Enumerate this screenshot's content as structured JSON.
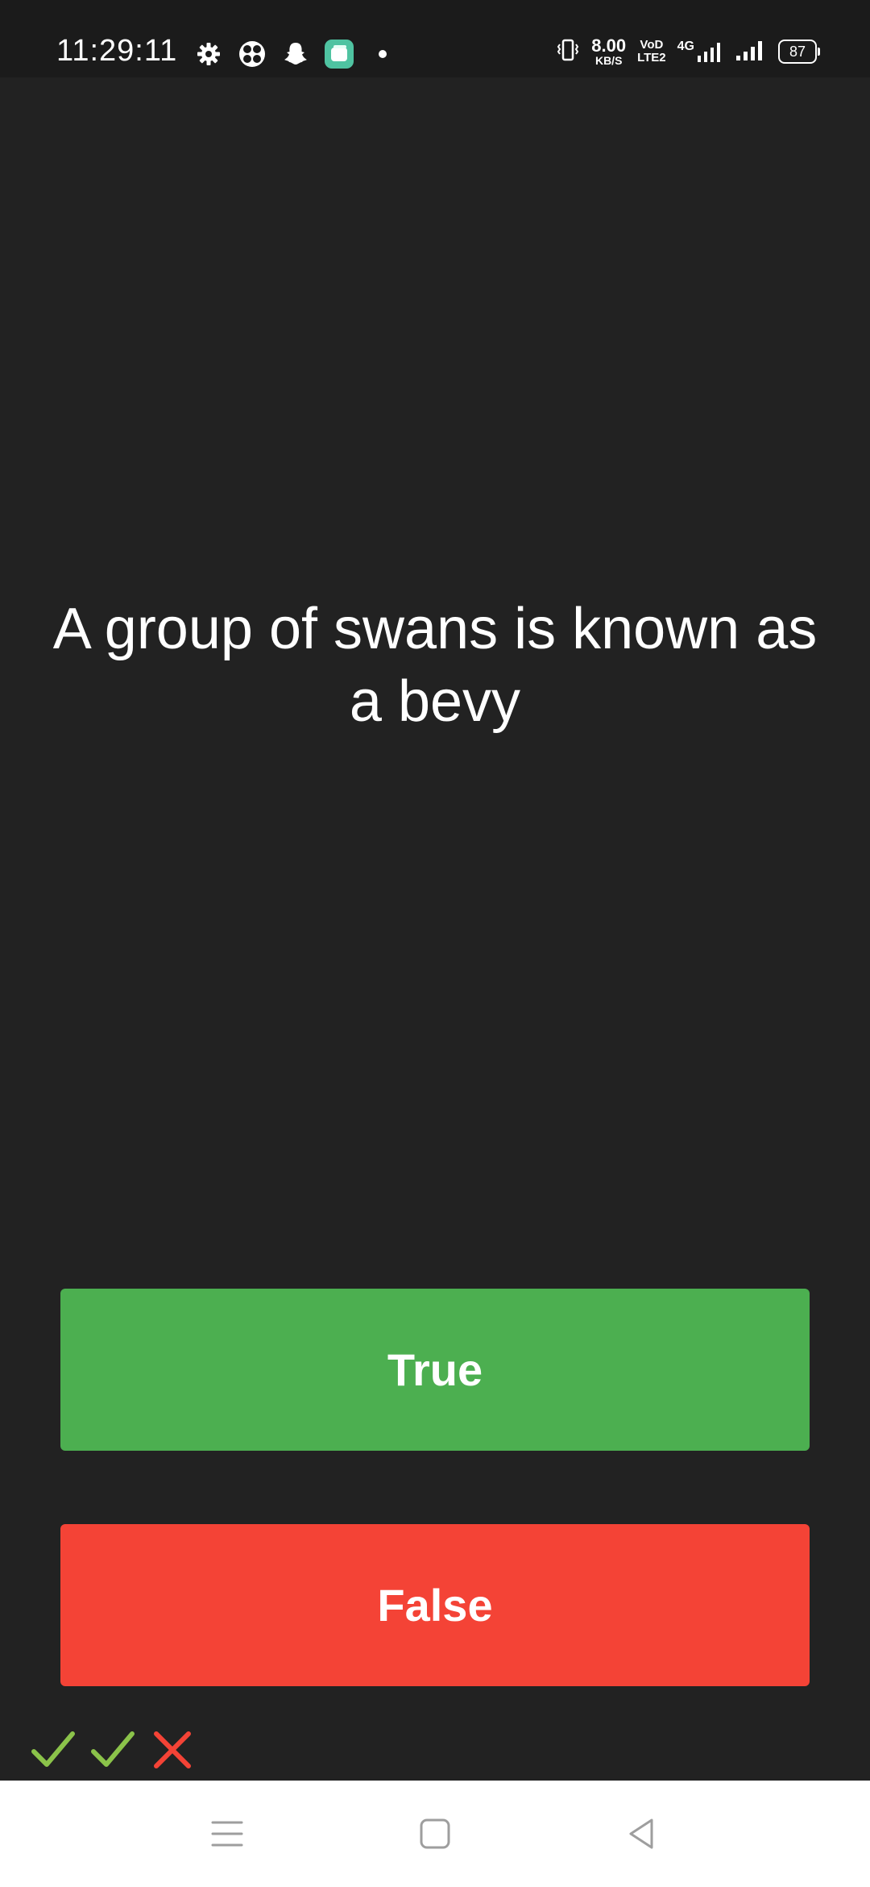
{
  "status_bar": {
    "time": "11:29:11",
    "left_icons": [
      "settings-icon",
      "fan-app-icon",
      "snapchat-icon",
      "app-notification-icon",
      "dot-icon"
    ],
    "network_speed_value": "8.00",
    "network_speed_unit": "KB/S",
    "volte_top": "VoD",
    "volte_bottom": "LTE2",
    "network_type": "4G",
    "battery_level": "87"
  },
  "quiz": {
    "question": "A group of swans is known as a bevy",
    "true_label": "True",
    "false_label": "False",
    "results": [
      "correct",
      "correct",
      "incorrect"
    ]
  },
  "colors": {
    "background": "#222222",
    "true_button": "#4caf50",
    "false_button": "#f44336",
    "correct_mark": "#8bc34a",
    "incorrect_mark": "#f44336"
  },
  "nav_bar": {
    "buttons": [
      "menu-icon",
      "home-icon",
      "back-icon"
    ]
  }
}
